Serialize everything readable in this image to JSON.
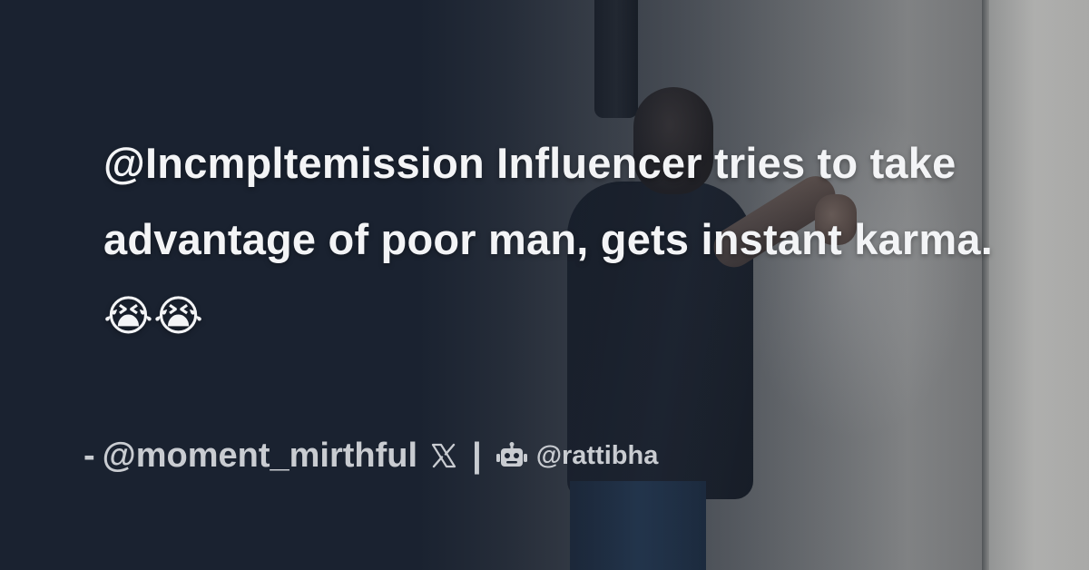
{
  "post": {
    "title": "@Incmpltemission Influencer tries to take advantage of poor man, gets instant karma.",
    "title_emoji": "😭😭"
  },
  "credit": {
    "dash": "-",
    "author": "@moment_mirthful",
    "platform_icon": "x-logo-icon",
    "separator": "|",
    "site_icon": "robot-icon",
    "site_handle": "@rattibha"
  },
  "colors": {
    "background": "#1a2230",
    "title_text": "#f3f4f6",
    "credit_text": "#c9ccd1"
  }
}
